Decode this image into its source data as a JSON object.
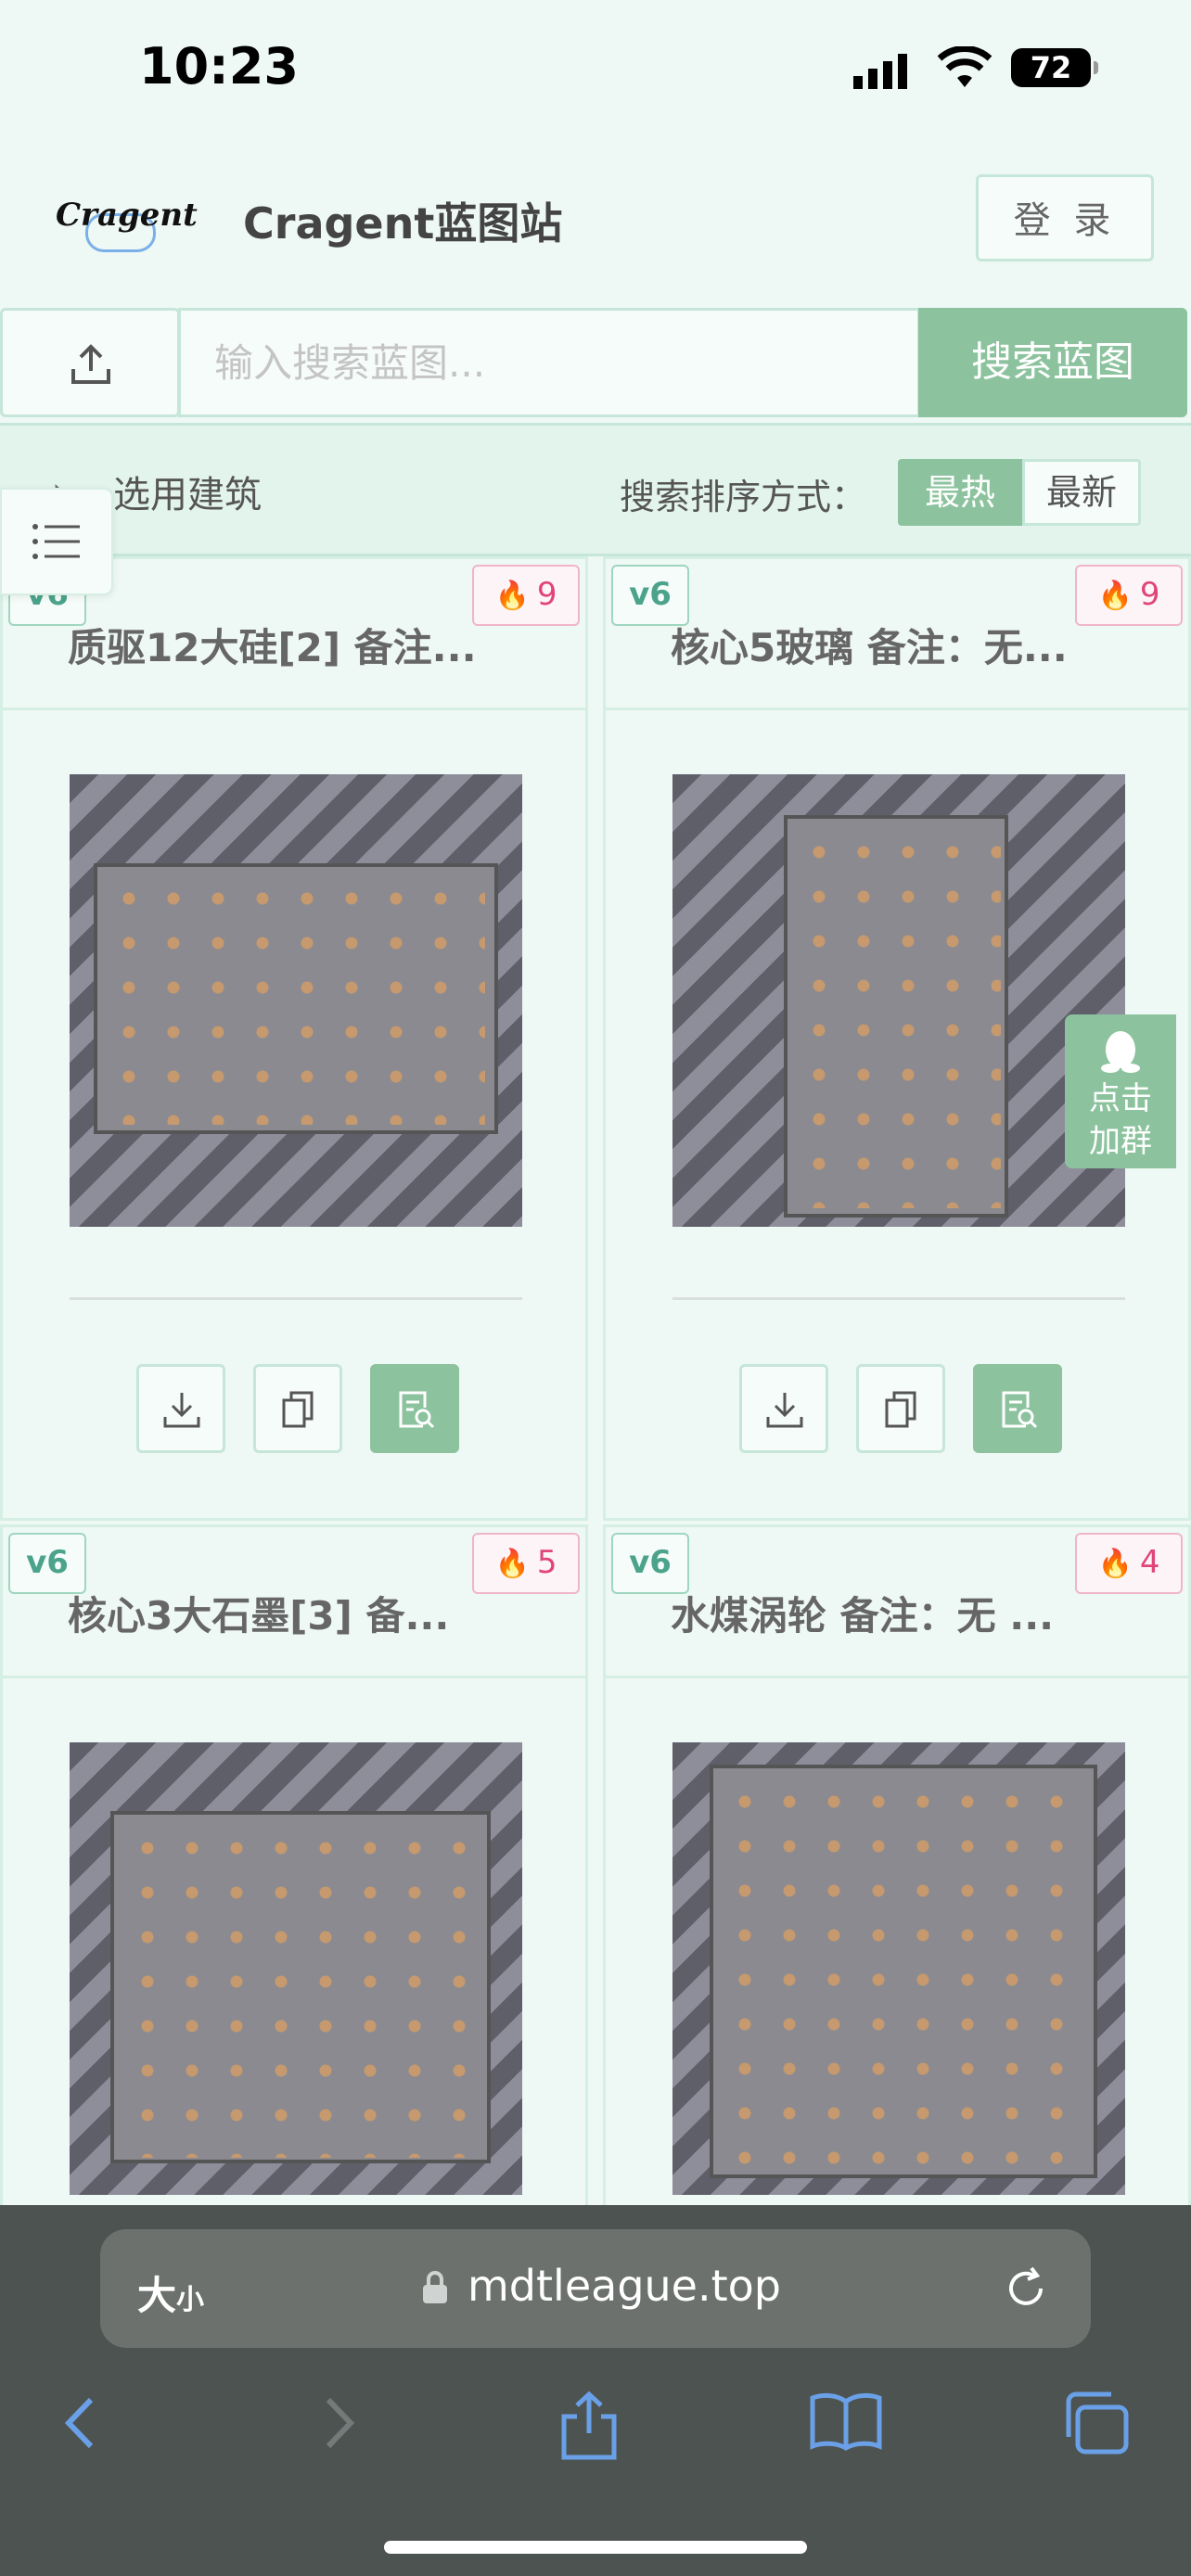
{
  "status": {
    "time": "10:23",
    "battery": "72"
  },
  "header": {
    "logo": "Cragent",
    "title": "Cragent蓝图站",
    "login": "登 录"
  },
  "search": {
    "placeholder": "输入搜索蓝图...",
    "button": "搜索蓝图"
  },
  "filter": {
    "select_label": "选用建筑",
    "sort_label": "搜索排序方式：",
    "sort_hot": "最热",
    "sort_new": "最新"
  },
  "cards": [
    {
      "version": "v6",
      "hot": "9",
      "title": "质驱12大硅[2] 备注..."
    },
    {
      "version": "v6",
      "hot": "9",
      "title": "核心5玻璃 备注：无..."
    },
    {
      "version": "v6",
      "hot": "5",
      "title": "核心3大石墨[3] 备..."
    },
    {
      "version": "v6",
      "hot": "4",
      "title": "水煤涡轮 备注：无 ..."
    }
  ],
  "qq": {
    "line1": "点击",
    "line2": "加群"
  },
  "browser": {
    "text_size": "大",
    "text_size_small": "小",
    "domain": "mdtleague.top"
  },
  "colors": {
    "accent": "#8cc39e",
    "border": "#c5e6d8",
    "hot": "#e0447a",
    "version": "#4aa38a"
  },
  "icons": [
    "upload-icon",
    "list-menu-icon",
    "download-icon",
    "copy-icon",
    "view-doc-icon",
    "flame-icon",
    "qq-penguin-icon",
    "lock-icon",
    "reload-icon",
    "back-icon",
    "forward-icon",
    "share-icon",
    "bookmarks-icon",
    "tabs-icon"
  ]
}
